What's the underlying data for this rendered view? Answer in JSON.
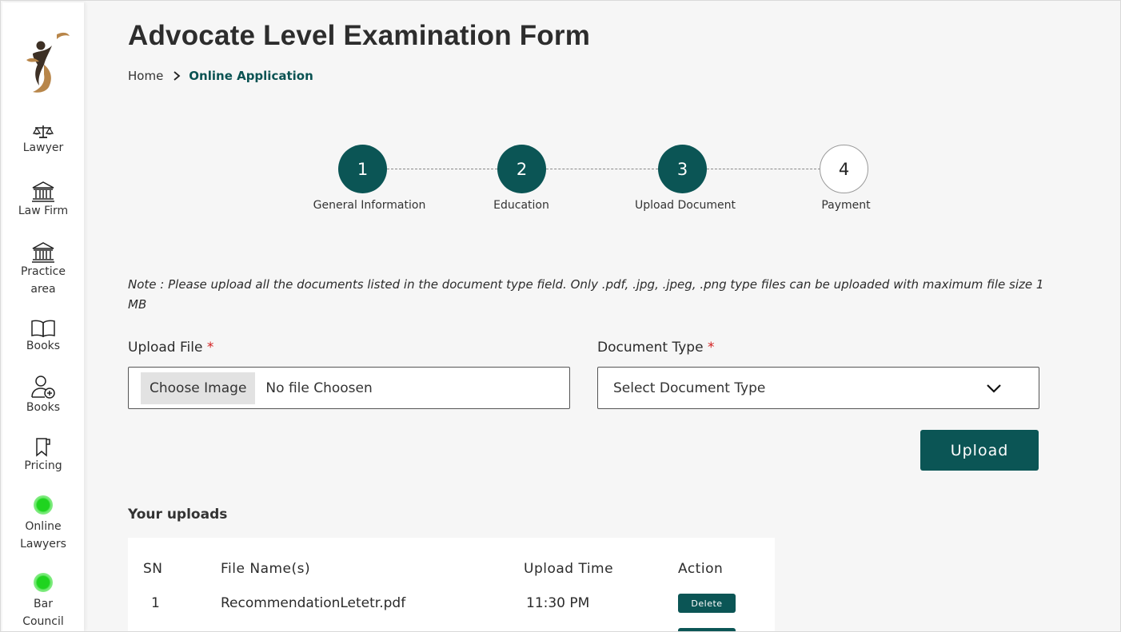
{
  "page": {
    "title": "Advocate Level Examination Form",
    "breadcrumb": {
      "home": "Home",
      "current": "Online Application"
    }
  },
  "sidebar": {
    "items": [
      {
        "label": "Lawyer",
        "icon": "scales-icon"
      },
      {
        "label": "Law Firm",
        "icon": "building-icon"
      },
      {
        "label": "Practice area",
        "icon": "building-icon"
      },
      {
        "label": "Books",
        "icon": "book-icon"
      },
      {
        "label": "Books",
        "icon": "add-user-icon"
      },
      {
        "label": "Pricing",
        "icon": "bookmark-icon"
      },
      {
        "label": "Online Lawyers",
        "icon": "online-dot-icon"
      },
      {
        "label": "Bar Council",
        "icon": "online-dot-icon"
      }
    ]
  },
  "stepper": {
    "steps": [
      {
        "number": "1",
        "label": "General Information",
        "state": "done"
      },
      {
        "number": "2",
        "label": "Education",
        "state": "done"
      },
      {
        "number": "3",
        "label": "Upload Document",
        "state": "active"
      },
      {
        "number": "4",
        "label": "Payment",
        "state": "pending"
      }
    ]
  },
  "note": {
    "prefix": "Note",
    "text": " : Please upload all the documents listed in the document type field. Only .pdf, .jpg, .jpeg, .png type files can be uploaded with maximum file size 1 MB"
  },
  "form": {
    "upload_file": {
      "label": "Upload File",
      "required": "*",
      "button": "Choose Image",
      "status": "No file Choosen"
    },
    "document_type": {
      "label": "Document Type",
      "required": "*",
      "selected": "Select Document Type"
    },
    "upload_button": "Upload"
  },
  "uploads": {
    "title": "Your uploads",
    "columns": [
      "SN",
      "File Name(s)",
      "Upload Time",
      "Action"
    ],
    "rows": [
      {
        "sn": "1",
        "file": "RecommendationLetetr.pdf",
        "time": "11:30 PM",
        "action": "Delete"
      }
    ]
  },
  "colors": {
    "primary": "#0b5555",
    "background": "#f6f6f6",
    "required": "#d32020",
    "online": "#1fd41f"
  }
}
